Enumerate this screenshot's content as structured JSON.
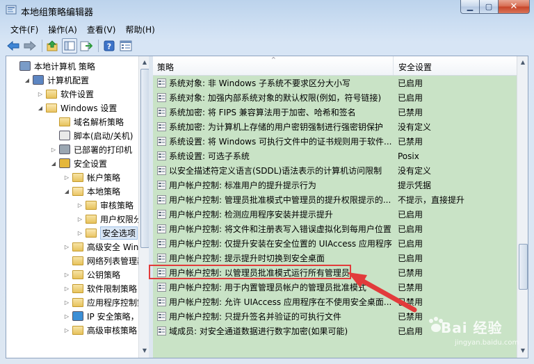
{
  "window": {
    "title": "本地组策略编辑器"
  },
  "menubar": [
    "文件(F)",
    "操作(A)",
    "查看(V)",
    "帮助(H)"
  ],
  "tree": [
    {
      "label": "本地计算机 策略",
      "level": 0,
      "expander": "",
      "icon": "computer-policy-icon"
    },
    {
      "label": "计算机配置",
      "level": 1,
      "expander": "open",
      "icon": "computer-icon"
    },
    {
      "label": "软件设置",
      "level": 2,
      "expander": "closed",
      "icon": "folder-icon"
    },
    {
      "label": "Windows 设置",
      "level": 2,
      "expander": "open",
      "icon": "folder-open-icon"
    },
    {
      "label": "域名解析策略",
      "level": 3,
      "expander": "",
      "icon": "folder-icon"
    },
    {
      "label": "脚本(启动/关机)",
      "level": 3,
      "expander": "",
      "icon": "script-icon"
    },
    {
      "label": "已部署的打印机",
      "level": 3,
      "expander": "closed",
      "icon": "printer-icon"
    },
    {
      "label": "安全设置",
      "level": 3,
      "expander": "open",
      "icon": "security-icon"
    },
    {
      "label": "帐户策略",
      "level": 4,
      "expander": "closed",
      "icon": "folder-icon"
    },
    {
      "label": "本地策略",
      "level": 4,
      "expander": "open",
      "icon": "folder-open-icon"
    },
    {
      "label": "审核策略",
      "level": 5,
      "expander": "closed",
      "icon": "folder-icon"
    },
    {
      "label": "用户权限分配",
      "level": 5,
      "expander": "closed",
      "icon": "folder-icon"
    },
    {
      "label": "安全选项",
      "level": 5,
      "expander": "closed",
      "icon": "folder-open-icon",
      "selected": true
    },
    {
      "label": "高级安全 Windo",
      "level": 4,
      "expander": "closed",
      "icon": "folder-icon"
    },
    {
      "label": "网络列表管理器",
      "level": 4,
      "expander": "",
      "icon": "folder-icon"
    },
    {
      "label": "公钥策略",
      "level": 4,
      "expander": "closed",
      "icon": "folder-icon"
    },
    {
      "label": "软件限制策略",
      "level": 4,
      "expander": "closed",
      "icon": "folder-icon"
    },
    {
      "label": "应用程序控制策",
      "level": 4,
      "expander": "closed",
      "icon": "folder-icon"
    },
    {
      "label": "IP 安全策略，在",
      "level": 4,
      "expander": "closed",
      "icon": "ip-security-icon"
    },
    {
      "label": "高级审核策略",
      "level": 4,
      "expander": "closed",
      "icon": "folder-icon"
    }
  ],
  "list": {
    "columns": {
      "policy": "策略",
      "setting": "安全设置"
    },
    "rows": [
      {
        "policy": "系统对象: 非 Windows 子系统不要求区分大小写",
        "setting": "已启用"
      },
      {
        "policy": "系统对象: 加强内部系统对象的默认权限(例如，符号链接)",
        "setting": "已启用"
      },
      {
        "policy": "系统加密: 将 FIPS 兼容算法用于加密、哈希和签名",
        "setting": "已禁用"
      },
      {
        "policy": "系统加密: 为计算机上存储的用户密钥强制进行强密钥保护",
        "setting": "没有定义"
      },
      {
        "policy": "系统设置: 将 Windows 可执行文件中的证书规则用于软件...",
        "setting": "已禁用"
      },
      {
        "policy": "系统设置: 可选子系统",
        "setting": "Posix"
      },
      {
        "policy": "以安全描述符定义语言(SDDL)语法表示的计算机访问限制",
        "setting": "没有定义"
      },
      {
        "policy": "用户帐户控制: 标准用户的提升提示行为",
        "setting": "提示凭据"
      },
      {
        "policy": "用户帐户控制: 管理员批准模式中管理员的提升权限提示的...",
        "setting": "不提示，直接提升"
      },
      {
        "policy": "用户帐户控制: 检测应用程序安装并提示提升",
        "setting": "已启用"
      },
      {
        "policy": "用户帐户控制: 将文件和注册表写入错误虚拟化到每用户位置",
        "setting": "已启用"
      },
      {
        "policy": "用户帐户控制: 仅提升安装在安全位置的 UIAccess 应用程序",
        "setting": "已启用"
      },
      {
        "policy": "用户帐户控制: 提示提升时切换到安全桌面",
        "setting": "已启用"
      },
      {
        "policy": "用户帐户控制: 以管理员批准模式运行所有管理员",
        "setting": "已禁用",
        "highlighted": true
      },
      {
        "policy": "用户帐户控制: 用于内置管理员帐户的管理员批准模式",
        "setting": "已禁用"
      },
      {
        "policy": "用户帐户控制: 允许 UIAccess 应用程序在不使用安全桌面...",
        "setting": "已禁用"
      },
      {
        "policy": "用户帐户控制: 只提升签名并验证的可执行文件",
        "setting": "已禁用"
      },
      {
        "policy": "域成员: 对安全通道数据进行数字加密(如果可能)",
        "setting": "已启用"
      },
      {
        "policy": "",
        "setting": ""
      }
    ]
  },
  "watermark": {
    "brand": "Bai 经验",
    "url": "jingyan.baidu.com"
  },
  "colors": {
    "list_bg": "#c9e3c6",
    "highlight": "#e23b3b",
    "arrow": "#e23b3b"
  }
}
